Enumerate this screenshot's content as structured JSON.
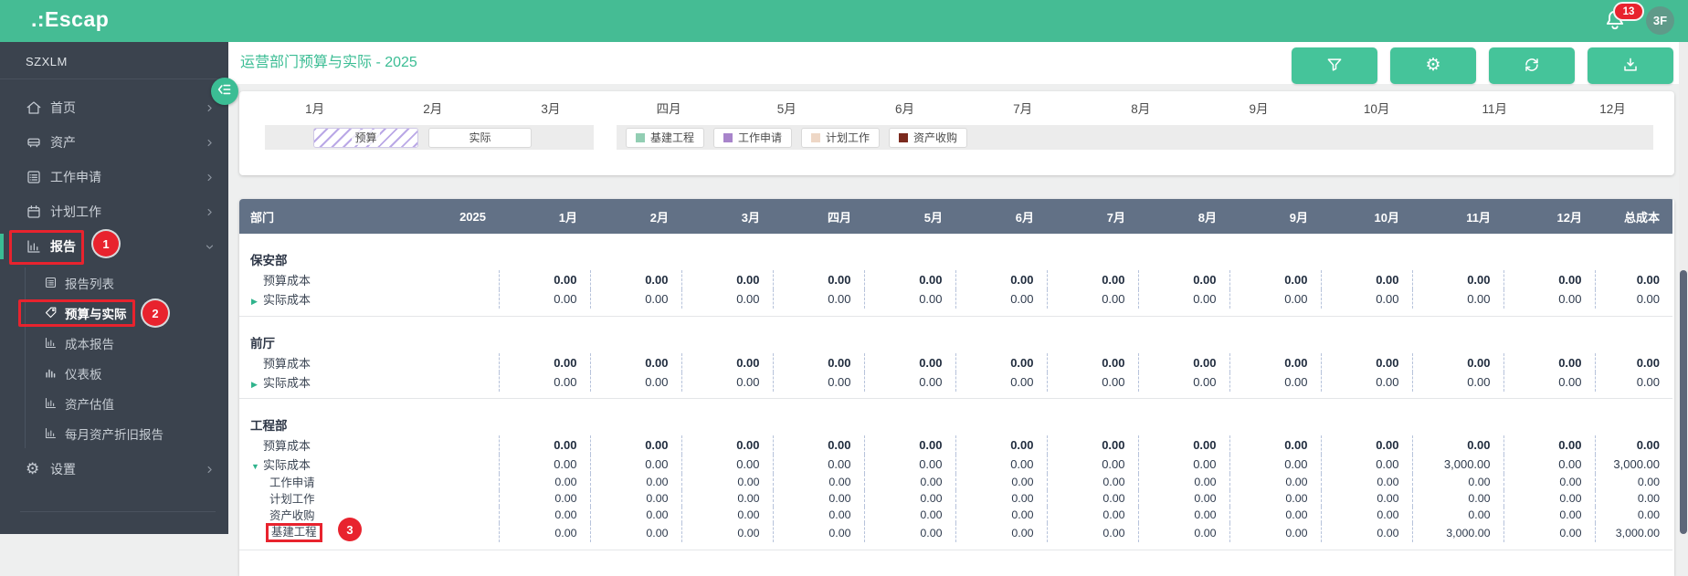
{
  "topbar": {
    "logo": ".:Escap",
    "notification_count": "13",
    "avatar": "3F"
  },
  "sidebar": {
    "org": "SZXLM",
    "menu": [
      {
        "id": "home",
        "label": "首页",
        "icon": "home",
        "chevron": "right"
      },
      {
        "id": "assets",
        "label": "资产",
        "icon": "asset",
        "chevron": "right"
      },
      {
        "id": "work-request",
        "label": "工作申请",
        "icon": "list",
        "chevron": "right"
      },
      {
        "id": "planned-work",
        "label": "计划工作",
        "icon": "calendar",
        "chevron": "right"
      },
      {
        "id": "reports",
        "label": "报告",
        "icon": "chart",
        "chevron": "down",
        "active": true
      }
    ],
    "submenu": [
      {
        "id": "report-list",
        "label": "报告列表",
        "icon": "list"
      },
      {
        "id": "budget-vs-actual",
        "label": "预算与实际",
        "icon": "tag",
        "active": true
      },
      {
        "id": "cost-report",
        "label": "成本报告",
        "icon": "chart"
      },
      {
        "id": "dashboard",
        "label": "仪表板",
        "icon": "bars"
      },
      {
        "id": "asset-valuation",
        "label": "资产估值",
        "icon": "chart"
      },
      {
        "id": "monthly-depreciation",
        "label": "每月资产折旧报告",
        "icon": "chart"
      }
    ],
    "settings_label": "设置"
  },
  "page": {
    "title": "运营部门预算与实际 - 2025"
  },
  "toolbar": {
    "buttons": [
      {
        "icon": "filter-icon"
      },
      {
        "icon": "gear-icon"
      },
      {
        "icon": "refresh-icon"
      },
      {
        "icon": "download-icon"
      }
    ]
  },
  "gantt": {
    "months": [
      "1月",
      "2月",
      "3月",
      "四月",
      "5月",
      "6月",
      "7月",
      "8月",
      "9月",
      "10月",
      "11月",
      "12月"
    ],
    "legend_budget": "预算",
    "legend_actual": "实际",
    "categories": [
      {
        "label": "基建工程",
        "color": "#92ceb3"
      },
      {
        "label": "工作申请",
        "color": "#a884cb"
      },
      {
        "label": "计划工作",
        "color": "#eed7c6"
      },
      {
        "label": "资产收购",
        "color": "#7b2a1e"
      }
    ]
  },
  "table": {
    "columns": [
      "部门",
      "2025",
      "1月",
      "2月",
      "3月",
      "四月",
      "5月",
      "6月",
      "7月",
      "8月",
      "9月",
      "10月",
      "11月",
      "12月",
      "总成本"
    ],
    "budget_row_label": "预算成本",
    "actual_row_label": "实际成本",
    "groups": [
      {
        "department": "保安部",
        "budget": {
          "values": [
            "0.00",
            "0.00",
            "0.00",
            "0.00",
            "0.00",
            "0.00",
            "0.00",
            "0.00",
            "0.00",
            "0.00",
            "0.00",
            "0.00"
          ],
          "total": "0.00"
        },
        "actual": {
          "expanded": false,
          "values": [
            "0.00",
            "0.00",
            "0.00",
            "0.00",
            "0.00",
            "0.00",
            "0.00",
            "0.00",
            "0.00",
            "0.00",
            "0.00",
            "0.00"
          ],
          "total": "0.00"
        },
        "subs": []
      },
      {
        "department": "前厅",
        "budget": {
          "values": [
            "0.00",
            "0.00",
            "0.00",
            "0.00",
            "0.00",
            "0.00",
            "0.00",
            "0.00",
            "0.00",
            "0.00",
            "0.00",
            "0.00"
          ],
          "total": "0.00"
        },
        "actual": {
          "expanded": false,
          "values": [
            "0.00",
            "0.00",
            "0.00",
            "0.00",
            "0.00",
            "0.00",
            "0.00",
            "0.00",
            "0.00",
            "0.00",
            "0.00",
            "0.00"
          ],
          "total": "0.00"
        },
        "subs": []
      },
      {
        "department": "工程部",
        "budget": {
          "values": [
            "0.00",
            "0.00",
            "0.00",
            "0.00",
            "0.00",
            "0.00",
            "0.00",
            "0.00",
            "0.00",
            "0.00",
            "0.00",
            "0.00"
          ],
          "total": "0.00"
        },
        "actual": {
          "expanded": true,
          "values": [
            "0.00",
            "0.00",
            "0.00",
            "0.00",
            "0.00",
            "0.00",
            "0.00",
            "0.00",
            "0.00",
            "0.00",
            "3,000.00",
            "0.00"
          ],
          "total": "3,000.00"
        },
        "subs": [
          {
            "label": "工作申请",
            "values": [
              "0.00",
              "0.00",
              "0.00",
              "0.00",
              "0.00",
              "0.00",
              "0.00",
              "0.00",
              "0.00",
              "0.00",
              "0.00",
              "0.00"
            ],
            "total": "0.00"
          },
          {
            "label": "计划工作",
            "values": [
              "0.00",
              "0.00",
              "0.00",
              "0.00",
              "0.00",
              "0.00",
              "0.00",
              "0.00",
              "0.00",
              "0.00",
              "0.00",
              "0.00"
            ],
            "total": "0.00"
          },
          {
            "label": "资产收购",
            "values": [
              "0.00",
              "0.00",
              "0.00",
              "0.00",
              "0.00",
              "0.00",
              "0.00",
              "0.00",
              "0.00",
              "0.00",
              "0.00",
              "0.00"
            ],
            "total": "0.00"
          },
          {
            "label": "基建工程",
            "values": [
              "0.00",
              "0.00",
              "0.00",
              "0.00",
              "0.00",
              "0.00",
              "0.00",
              "0.00",
              "0.00",
              "0.00",
              "3,000.00",
              "0.00"
            ],
            "total": "3,000.00",
            "badge": true
          }
        ]
      }
    ]
  },
  "annotations": {
    "step1": "1",
    "step2": "2",
    "step3": "3"
  }
}
